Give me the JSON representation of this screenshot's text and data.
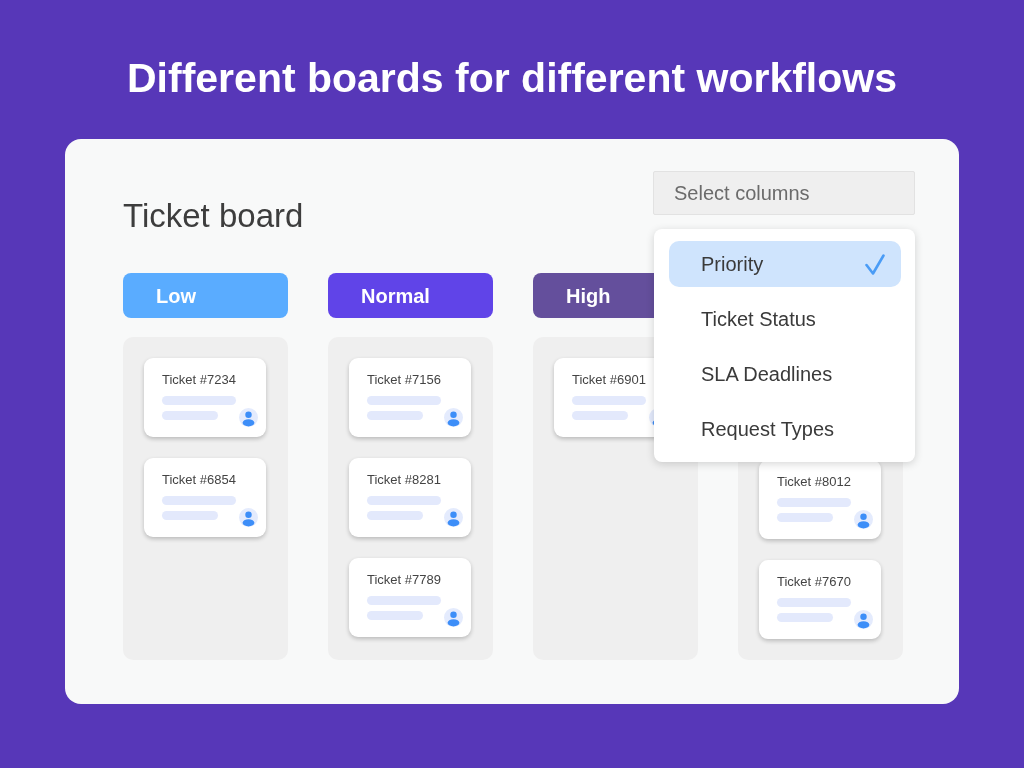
{
  "headline": "Different boards for different workflows",
  "board": {
    "title": "Ticket board",
    "column_picker": {
      "placeholder": "Select columns",
      "options": [
        {
          "label": "Priority",
          "selected": true
        },
        {
          "label": "Ticket Status",
          "selected": false
        },
        {
          "label": "SLA Deadlines",
          "selected": false
        },
        {
          "label": "Request Types",
          "selected": false
        }
      ]
    },
    "columns": [
      {
        "title": "Low",
        "color": "#5aacff",
        "tickets": [
          {
            "title": "Ticket #7234"
          },
          {
            "title": "Ticket #6854"
          }
        ]
      },
      {
        "title": "Normal",
        "color": "#6044e8",
        "tickets": [
          {
            "title": "Ticket #7156"
          },
          {
            "title": "Ticket #8281"
          },
          {
            "title": "Ticket #7789"
          }
        ]
      },
      {
        "title": "High",
        "color": "#644f9c",
        "tickets": [
          {
            "title": "Ticket #6901"
          }
        ]
      },
      {
        "tickets": [
          {
            "title": "Ticket #8012"
          },
          {
            "title": "Ticket #7670"
          }
        ]
      }
    ]
  }
}
